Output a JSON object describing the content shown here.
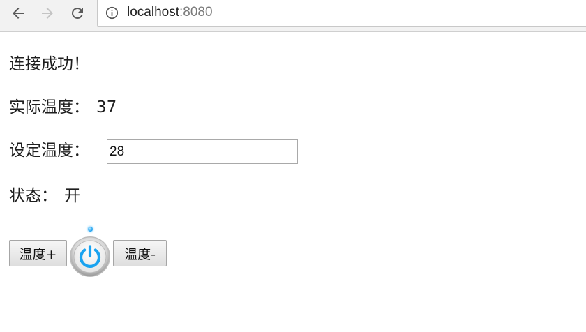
{
  "browser": {
    "url_host": "localhost",
    "url_port": ":8080",
    "icons": {
      "back": "arrow-left-icon",
      "forward": "arrow-right-icon",
      "reload": "reload-icon",
      "info": "info-icon"
    }
  },
  "page": {
    "status_message": "连接成功！",
    "actual_temp_label": "实际温度：",
    "actual_temp_value": "37",
    "set_temp_label": "设定温度：",
    "set_temp_value": "28",
    "state_label": "状态：",
    "state_value": "开",
    "temp_up_label": "温度+",
    "temp_down_label": "温度-",
    "power_icon": "power-icon",
    "accent_color": "#1aa3f0"
  }
}
